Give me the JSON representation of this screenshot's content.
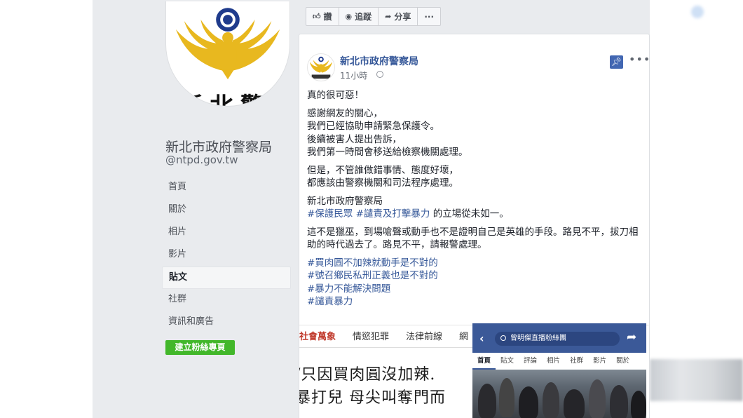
{
  "sidebar": {
    "page_name": "新北市政府警察局",
    "page_handle": "@ntpd.gov.tw",
    "logo_text": "新北警察",
    "nav": [
      {
        "label": "首頁",
        "active": false
      },
      {
        "label": "關於",
        "active": false
      },
      {
        "label": "相片",
        "active": false
      },
      {
        "label": "影片",
        "active": false
      },
      {
        "label": "貼文",
        "active": true
      },
      {
        "label": "社群",
        "active": false
      },
      {
        "label": "資訊和廣告",
        "active": false
      }
    ],
    "create_button": "建立粉絲專頁"
  },
  "actions": [
    {
      "icon": "like-icon",
      "label": "讚"
    },
    {
      "icon": "follow-icon",
      "label": "追蹤"
    },
    {
      "icon": "share-icon",
      "label": "分享"
    },
    {
      "icon": "more-icon",
      "label": "···"
    }
  ],
  "post": {
    "author": "新北市政府警察局",
    "time": "11小時",
    "more": "•••",
    "lines": {
      "l1": "真的很可惡！",
      "p2a": "感謝網友的關心，",
      "p2b": "我們已經協助申請緊急保護令。",
      "p2c": "後續被害人提出告訴，",
      "p2d": "我們第一時間會移送給檢察機關處理。",
      "p3a": "但是，不管誰做錯事情、態度好壞，",
      "p3b": "都應該由警察機關和司法程序處理。",
      "p4a": "新北市政府警察局",
      "p4_tag1": "#保護民眾",
      "p4_tag2": "#譴責及打擊暴力",
      "p4_rest": " 的立場從未如一。",
      "p5": "這不是獵巫，到場嗆聲或動手也不是證明自己是英雄的手段。路見不平，拔刀相助的時代過去了。路見不平，請報警處理。",
      "h1": "#買肉圓不加辣就動手是不對的",
      "h2": "#號召鄉民私刑正義也是不對的",
      "h3": "#暴力不能解決問題",
      "h4": "#譴責暴力"
    }
  },
  "media": {
    "tabs": [
      "社會萬象",
      "情慾犯罪",
      "法律前線",
      "網"
    ],
    "headline1": "/只因買肉圓沒加辣.",
    "headline2": "暴打兒 母尖叫奪門而"
  },
  "phone": {
    "search_text": "曾明傑直播粉絲團",
    "tabs": [
      "首頁",
      "貼文",
      "評論",
      "相片",
      "社群",
      "影片",
      "關於"
    ]
  },
  "colors": {
    "link": "#365899",
    "green_button": "#42b72a",
    "fb_blue": "#3b5998",
    "pin_blue": "#4267b2"
  }
}
